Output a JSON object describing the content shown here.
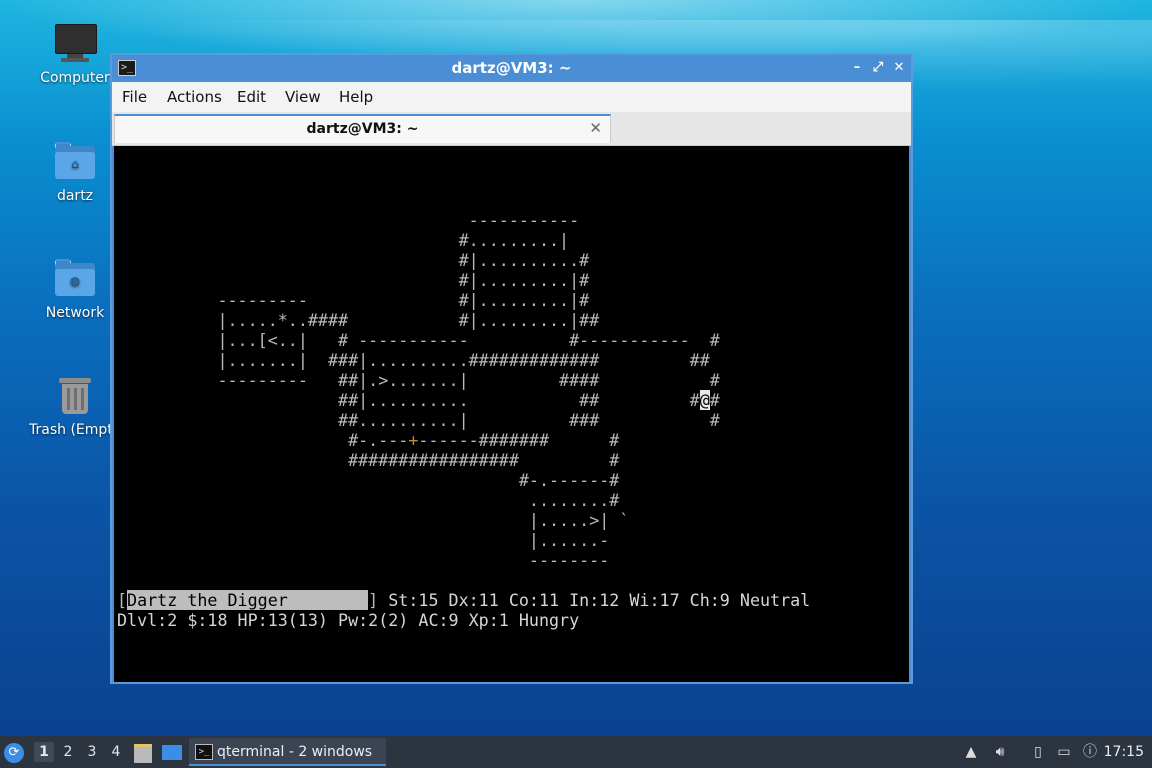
{
  "desktop": {
    "icons": [
      {
        "label": "Computer",
        "icon": "computer-icon"
      },
      {
        "label": "dartz",
        "icon": "home-folder-icon"
      },
      {
        "label": "Network",
        "icon": "network-folder-icon"
      },
      {
        "label": "Trash (Empty)",
        "icon": "trash-icon"
      }
    ]
  },
  "window": {
    "title": "dartz@VM3: ~",
    "controls": {
      "minimize": "–",
      "maximize": "⤢",
      "close": "✕"
    },
    "menu": [
      "File",
      "Actions",
      "Edit",
      "View",
      "Help"
    ],
    "tab": {
      "label": "dartz@VM3: ~",
      "close": "✕"
    }
  },
  "terminal": {
    "map_lines": [
      "",
      "",
      "",
      "                                   -----------",
      "                                  #.........|",
      "                                  #|..........#",
      "                                  #|.........|#",
      "          ---------               #|.........|#",
      "          |.....*..####           #|.........|##",
      "          |...[<..|   # -----------          #-----------  #",
      "          |.......|  ###|..........#############         ##",
      "          ---------   ##|.>.......|         ####           #",
      "                      ##|..........           ##         #@#",
      "                      ##..........|          ###           #",
      "                       #-.---+------#######      #",
      "                       #################         #",
      "                                        #-.------#",
      "                                         ........#",
      "                                         |.....>| `",
      "                                         |......-",
      "                                         --------"
    ],
    "name_field": "Dartz the Digger        ",
    "stats_line1": "St:15 Dx:11 Co:11 In:12 Wi:17 Ch:9 Neutral",
    "stats_line2": "Dlvl:2 $:18 HP:13(13) Pw:2(2) AC:9 Xp:1 Hungry"
  },
  "taskbar": {
    "desktops": [
      "1",
      "2",
      "3",
      "4"
    ],
    "active_desktop": "1",
    "task_label": "qterminal - 2 windows",
    "clock": "17:15",
    "tray_icons": [
      "up-arrow-icon",
      "volume-icon",
      "clipboard-icon",
      "network-icon",
      "notification-icon"
    ]
  },
  "colors": {
    "window_accent": "#4a8ed6",
    "taskbar_bg": "#2c3440",
    "terminal_bg": "#000000"
  }
}
